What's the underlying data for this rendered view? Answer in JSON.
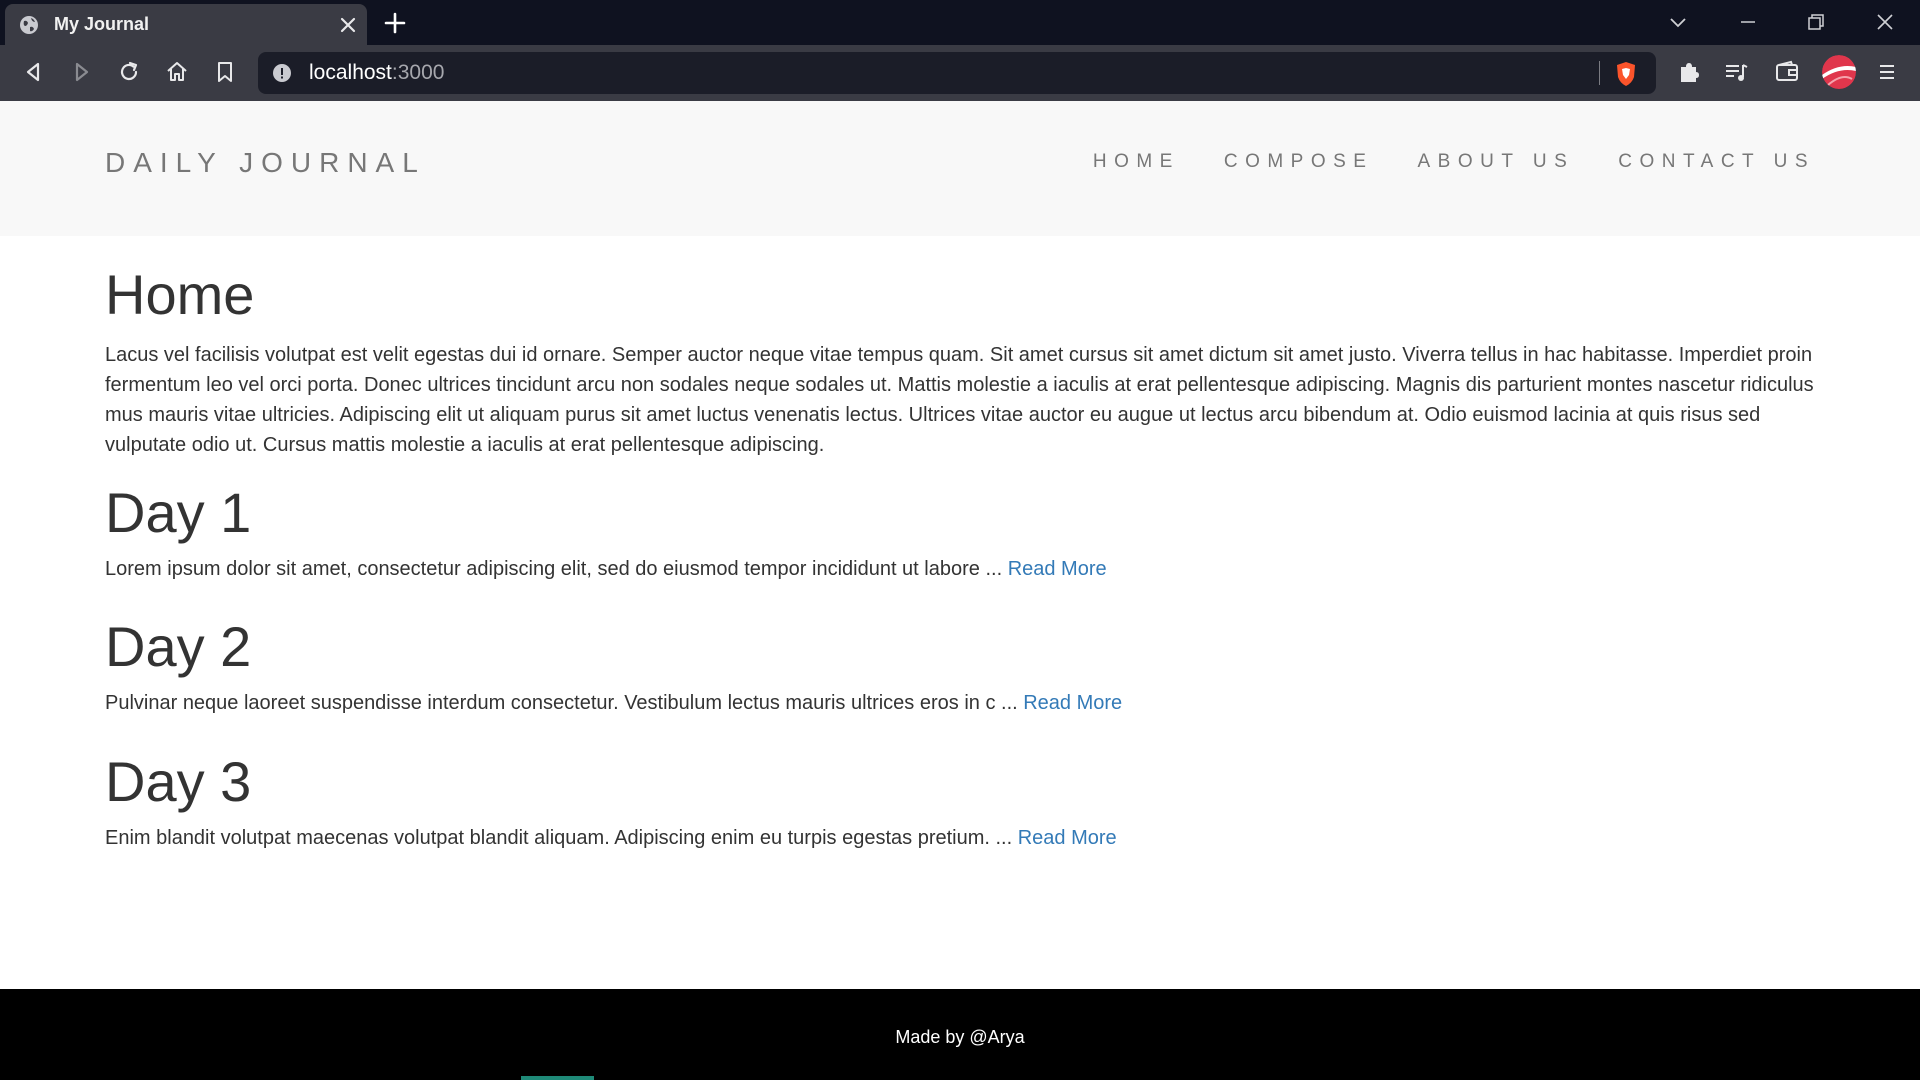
{
  "browser": {
    "tab": {
      "title": "My Journal",
      "favicon": "globe-icon"
    },
    "url": {
      "host": "localhost",
      "port": ":3000"
    },
    "icons": {
      "back": "back-arrow-icon",
      "forward": "forward-arrow-icon",
      "reload": "reload-icon",
      "home": "home-icon",
      "bookmark": "bookmark-icon",
      "site_info": "info-icon",
      "brave": "brave-shield-icon",
      "extensions": "puzzle-icon",
      "playlist": "playlist-icon",
      "wallet": "wallet-icon",
      "menu": "hamburger-menu-icon"
    }
  },
  "site": {
    "brand": "DAILY JOURNAL",
    "nav": [
      {
        "label": "HOME"
      },
      {
        "label": "COMPOSE"
      },
      {
        "label": "ABOUT US"
      },
      {
        "label": "CONTACT US"
      }
    ]
  },
  "home": {
    "heading": "Home",
    "paragraph": "Lacus vel facilisis volutpat est velit egestas dui id ornare. Semper auctor neque vitae tempus quam. Sit amet cursus sit amet dictum sit amet justo. Viverra tellus in hac habitasse. Imperdiet proin fermentum leo vel orci porta. Donec ultrices tincidunt arcu non sodales neque sodales ut. Mattis molestie a iaculis at erat pellentesque adipiscing. Magnis dis parturient montes nascetur ridiculus mus mauris vitae ultricies. Adipiscing elit ut aliquam purus sit amet luctus venenatis lectus. Ultrices vitae auctor eu augue ut lectus arcu bibendum at. Odio euismod lacinia at quis risus sed vulputate odio ut. Cursus mattis molestie a iaculis at erat pellentesque adipiscing."
  },
  "posts": [
    {
      "title": "Day 1",
      "excerpt": "Lorem ipsum dolor sit amet, consectetur adipiscing elit, sed do eiusmod tempor incididunt ut labore ... ",
      "link": "Read More"
    },
    {
      "title": "Day 2",
      "excerpt": "Pulvinar neque laoreet suspendisse interdum consectetur. Vestibulum lectus mauris ultrices eros in c ... ",
      "link": "Read More"
    },
    {
      "title": "Day 3",
      "excerpt": "Enim blandit volutpat maecenas volutpat blandit aliquam. Adipiscing enim eu turpis egestas pretium. ... ",
      "link": "Read More"
    }
  ],
  "footer": {
    "text": "Made by @Arya"
  },
  "colors": {
    "link": "#337ab7",
    "nav_bg": "#f8f8f8",
    "footer_bg": "#000000",
    "text": "#333333",
    "muted": "#777777"
  }
}
